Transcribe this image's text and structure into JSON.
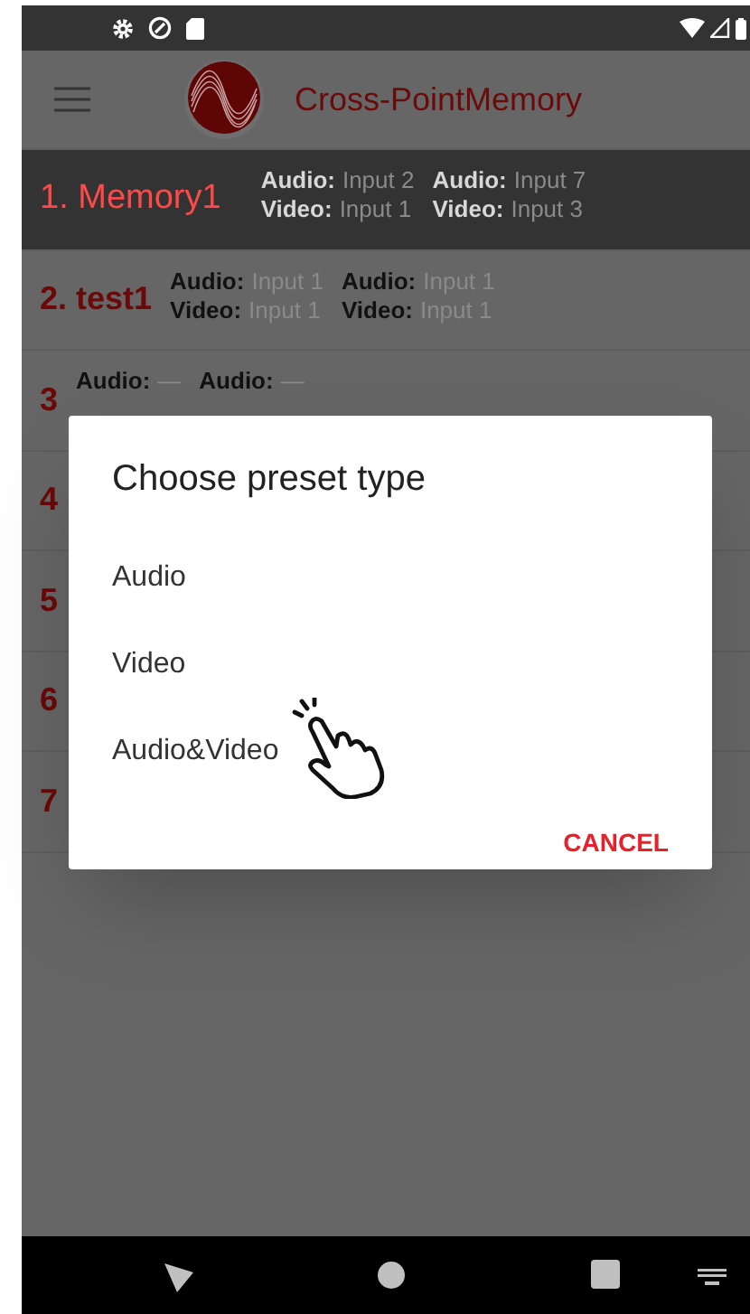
{
  "app_bar": {
    "title": "Cross-PointMemory"
  },
  "presets": [
    {
      "label": "1. Memory1",
      "selected": true,
      "routes": [
        {
          "audio_label": "Audio:",
          "audio": "Input 2",
          "video_label": "Video:",
          "video": "Input 1"
        },
        {
          "audio_label": "Audio:",
          "audio": "Input 7",
          "video_label": "Video:",
          "video": "Input 3"
        }
      ]
    },
    {
      "label": "2. test1",
      "selected": false,
      "routes": [
        {
          "audio_label": "Audio:",
          "audio": "Input 1",
          "video_label": "Video:",
          "video": "Input 1"
        },
        {
          "audio_label": "Audio:",
          "audio": "Input 1",
          "video_label": "Video:",
          "video": "Input 1"
        }
      ]
    },
    {
      "label": "3",
      "selected": false,
      "routes": [
        {
          "audio_label": "Audio:",
          "audio": "—"
        },
        {
          "audio_label": "Audio:",
          "audio": "—"
        }
      ]
    },
    {
      "label": "4",
      "selected": false
    },
    {
      "label": "5",
      "selected": false
    },
    {
      "label": "6",
      "selected": false
    },
    {
      "label": "7",
      "selected": false
    }
  ],
  "dialog": {
    "title": "Choose preset type",
    "options": [
      "Audio",
      "Video",
      "Audio&Video"
    ],
    "button": "CANCEL"
  }
}
